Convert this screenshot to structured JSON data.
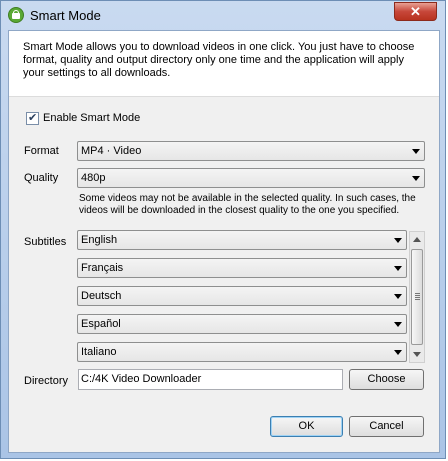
{
  "window": {
    "title": "Smart Mode",
    "close_glyph": "✕"
  },
  "description": "Smart Mode allows you to download videos in one click. You just have to choose format, quality and output directory only one time and the application will apply your settings to all downloads.",
  "enable": {
    "label": "Enable Smart Mode",
    "checked": true
  },
  "format": {
    "label": "Format",
    "value": "MP4 · Video"
  },
  "quality": {
    "label": "Quality",
    "value": "480p"
  },
  "quality_note": "Some videos may not be available in the selected quality. In such cases, the videos will be downloaded in the closest quality to the one you specified.",
  "subtitles": {
    "label": "Subtitles",
    "languages": [
      "English",
      "Français",
      "Deutsch",
      "Español",
      "Italiano"
    ]
  },
  "directory": {
    "label": "Directory",
    "value": "C:/4K Video Downloader",
    "choose_label": "Choose"
  },
  "buttons": {
    "ok": "OK",
    "cancel": "Cancel"
  },
  "icons": {
    "app": "lock-icon",
    "close": "close-icon"
  }
}
